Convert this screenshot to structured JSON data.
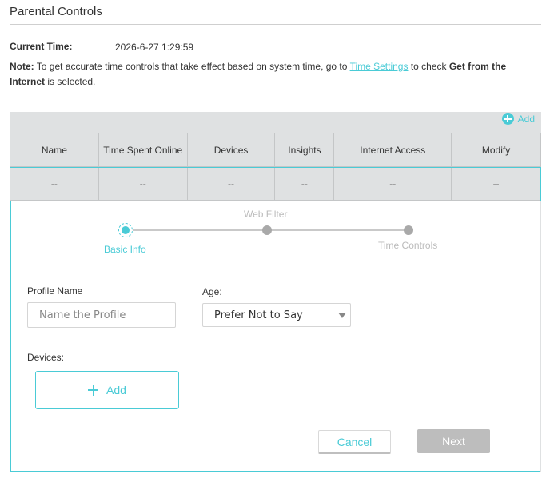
{
  "page": {
    "title": "Parental Controls"
  },
  "current_time": {
    "label": "Current Time:",
    "value": "2026-6-27 1:29:59"
  },
  "note": {
    "label": "Note:",
    "text_before": " To get accurate time controls that take effect based on system time, go to ",
    "link": "Time Settings",
    "text_middle": " to check ",
    "bold_text": "Get from the Internet",
    "text_after": " is selected."
  },
  "table": {
    "add_label": "Add",
    "columns": [
      "Name",
      "Time Spent Online",
      "Devices",
      "Insights",
      "Internet Access",
      "Modify"
    ],
    "rows": [
      [
        "--",
        "--",
        "--",
        "--",
        "--",
        "--"
      ]
    ]
  },
  "wizard": {
    "steps": [
      "Basic Info",
      "Web Filter",
      "Time Controls"
    ],
    "active_step": 0
  },
  "form": {
    "profile_name_label": "Profile Name",
    "profile_name_placeholder": "Name the Profile",
    "profile_name_value": "",
    "age_label": "Age:",
    "age_value": "Prefer Not to Say",
    "devices_label": "Devices:",
    "devices_add_label": "Add",
    "cancel_label": "Cancel",
    "next_label": "Next"
  },
  "colors": {
    "accent": "#4acbd6",
    "panel_bg": "#dfe1e2",
    "disabled_button": "#bdbdbd",
    "inactive_step": "#a9a9a9"
  },
  "icons": {
    "add_top": "plus-circle-icon",
    "devices_add": "plus-icon",
    "age_dropdown": "caret-down-icon"
  }
}
